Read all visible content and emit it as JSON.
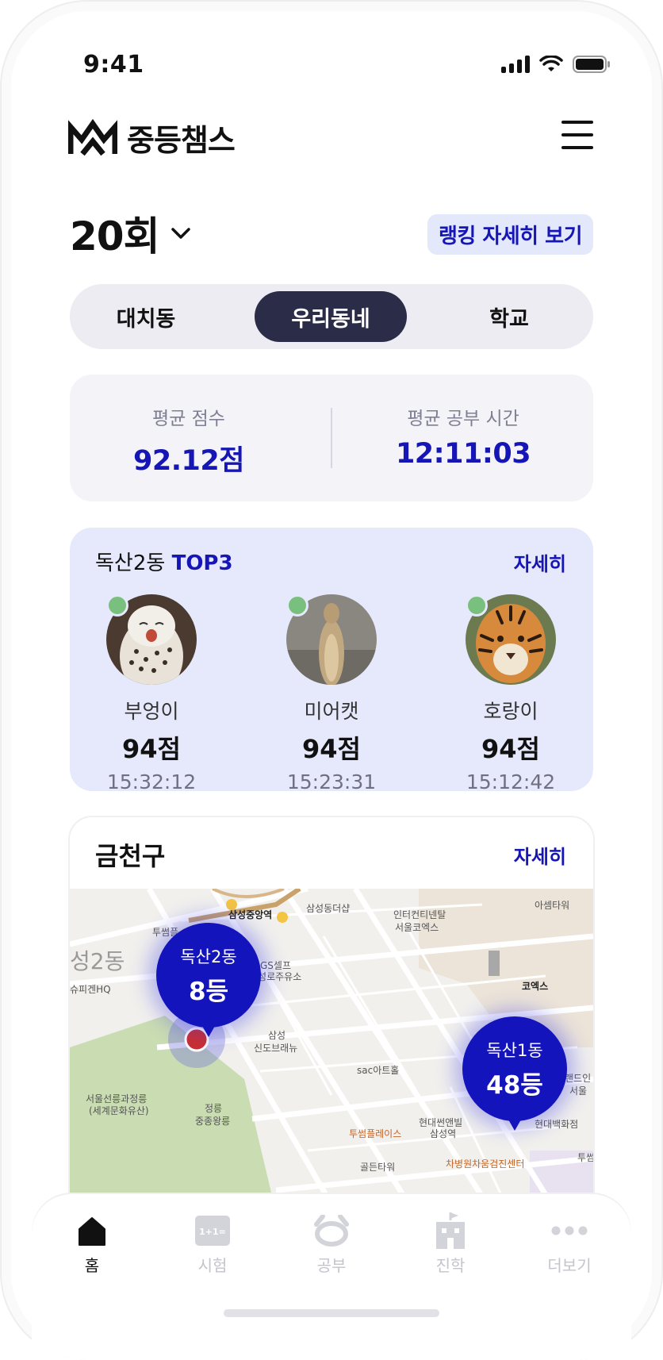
{
  "status_bar": {
    "time": "9:41"
  },
  "header": {
    "logo_text": "중등챔스"
  },
  "round": {
    "label": "20회",
    "ranking_button": "랭킹 자세히 보기"
  },
  "segments": [
    {
      "label": "대치동",
      "active": false
    },
    {
      "label": "우리동네",
      "active": true
    },
    {
      "label": "학교",
      "active": false
    }
  ],
  "stats": {
    "avg_score_label": "평균 점수",
    "avg_score_value": "92.12점",
    "avg_time_label": "평균 공부 시간",
    "avg_time_value": "12:11:03"
  },
  "top3": {
    "area": "독산2동",
    "badge": "TOP3",
    "more": "자세히",
    "items": [
      {
        "name": "부엉이",
        "score": "94점",
        "time": "15:32:12",
        "avatar": "owl"
      },
      {
        "name": "미어캣",
        "score": "94점",
        "time": "15:23:31",
        "avatar": "meerkat"
      },
      {
        "name": "호랑이",
        "score": "94점",
        "time": "15:12:42",
        "avatar": "tiger"
      }
    ]
  },
  "district": {
    "title": "금천구",
    "more": "자세히",
    "map_labels": {
      "l1": "삼성중앙역",
      "l2": "삼성동더샵",
      "l3": "인터컨티넨탈",
      "l3b": "서울코엑스",
      "l4": "아셈타워",
      "l5": "투썸플",
      "l6": "성2동",
      "l7": "GS셀프",
      "l7b": "삼성로주유소",
      "l8": "슈피겐HQ",
      "l9": "코엑스",
      "l10": "삼성",
      "l10b": "신도브래뉴",
      "l11": "sac아트홀",
      "l12": "서울선릉과정릉",
      "l12b": "(세계문화유산)",
      "l13": "정릉",
      "l13b": "중종왕릉",
      "l14": "투썸플레이스",
      "l15": "현대썬앤빌",
      "l15b": "삼성역",
      "l16": "현대백화점",
      "l17": "골든타워",
      "l18": "차병원차움검진센터",
      "l19": "랜드인",
      "l19b": "서울",
      "l20": "투썸"
    },
    "pins": [
      {
        "name": "독산2동",
        "rank": "8등"
      },
      {
        "name": "독산1동",
        "rank": "48등"
      }
    ]
  },
  "tabs": [
    {
      "label": "홈",
      "icon": "home-icon",
      "active": true
    },
    {
      "label": "시험",
      "icon": "exam-icon",
      "active": false
    },
    {
      "label": "공부",
      "icon": "study-icon",
      "active": false
    },
    {
      "label": "진학",
      "icon": "school-icon",
      "active": false
    },
    {
      "label": "더보기",
      "icon": "more-icon",
      "active": false
    }
  ],
  "colors": {
    "accent": "#1616b6",
    "segment_active": "#2b2c47",
    "card_tint": "#e6e9fb",
    "online": "#79c07f"
  }
}
